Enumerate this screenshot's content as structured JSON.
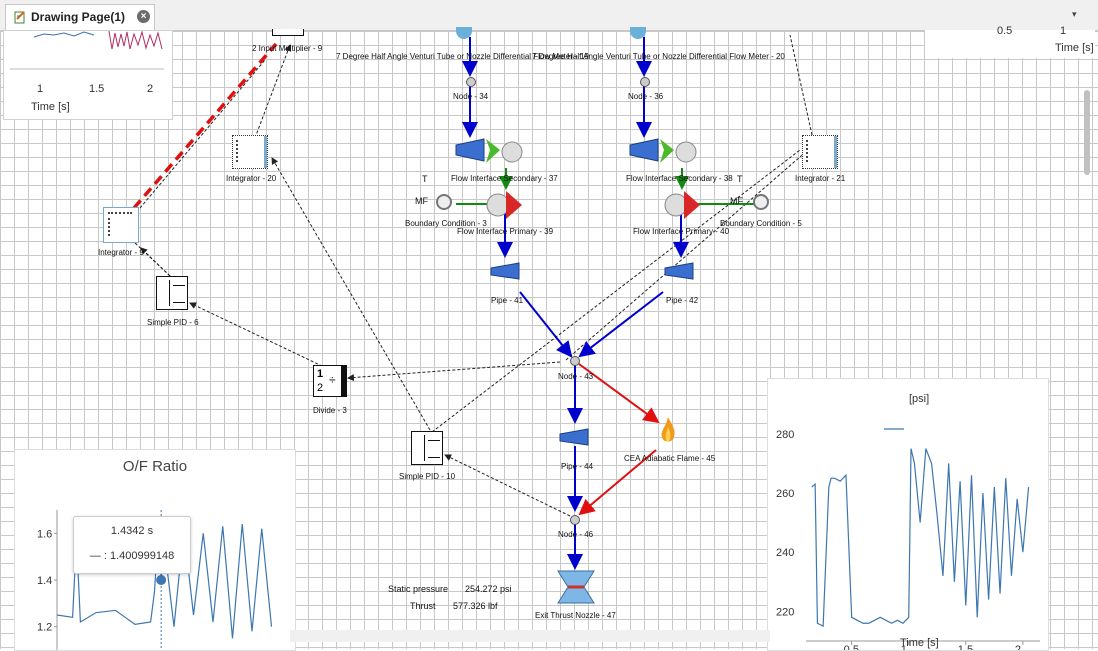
{
  "tab": {
    "title": "Drawing Page(1)",
    "close": "×"
  },
  "dropdown_icon": "▾",
  "components": {
    "multiplier": "2 Input Multiplier - 9",
    "venturi_left": "7 Degree Half Angle Venturi Tube or Nozzle Differential Flow Meter - 19",
    "venturi_right": "7 Degree Half Angle Venturi Tube or Nozzle Differential Flow Meter - 20",
    "node_left_top": "Node - 34",
    "node_right_top": "Node - 36",
    "integrator_20": "Integrator - 20",
    "integrator_21": "Integrator - 21",
    "integrator_9": "Integrator - 9",
    "flow_sec_left": "Flow Interface Secondary - 37",
    "flow_sec_right": "Flow Interface Secondary - 38",
    "t_left": "T",
    "mf_left": "MF",
    "t_right": "T",
    "mf_right": "MF",
    "boundary_3": "Boundary Condition - 3",
    "boundary_5": "Boundary Condition - 5",
    "flow_pri_left": "Flow Interface Primary - 39",
    "flow_pri_right": "Flow Interface Primary - 40",
    "pipe_41": "Pipe - 41",
    "pipe_42": "Pipe - 42",
    "pid_6": "Simple PID - 6",
    "node_43": "Node - 43",
    "divide_3": "Divide - 3",
    "divide_num": "1",
    "divide_den": "2",
    "divide_sym": "÷",
    "pipe_44": "Pipe - 44",
    "flame_45": "CEA Adiabatic Flame - 45",
    "pid_10": "Simple PID - 10",
    "node_46": "Node - 46",
    "nozzle_47": "Exit Thrust Nozzle - 47"
  },
  "readouts": {
    "static_pressure_label": "Static pressure",
    "static_pressure_value": "254.272 psi",
    "thrust_label": "Thrust",
    "thrust_value": "577.326 lbf"
  },
  "plot_topleft": {
    "ticks": [
      "1",
      "1.5",
      "2"
    ],
    "xlabel": "Time [s]"
  },
  "plot_topright": {
    "ticks": [
      "0.5",
      "1"
    ],
    "xlabel": "Time [s]"
  },
  "chart_data": [
    {
      "type": "line",
      "title": "O/F Ratio",
      "ylim": [
        1.1,
        1.7
      ],
      "yticks": [
        "1.6",
        "1.4",
        "1.2"
      ],
      "xlim": [
        0.9,
        2.1
      ],
      "tooltip": {
        "time": "1.4342 s",
        "value": "— : 1.400999148"
      },
      "series": [
        {
          "x": [
            0.9,
            0.98,
            1.0,
            1.02,
            1.1,
            1.2,
            1.3,
            1.38,
            1.4,
            1.42,
            1.434,
            1.45,
            1.5,
            1.55,
            1.6,
            1.65,
            1.7,
            1.75,
            1.8,
            1.85,
            1.9,
            1.95,
            2.0
          ],
          "y": [
            1.25,
            1.24,
            1.58,
            1.22,
            1.26,
            1.27,
            1.21,
            1.22,
            1.35,
            1.62,
            1.4,
            1.55,
            1.2,
            1.62,
            1.25,
            1.6,
            1.22,
            1.63,
            1.15,
            1.64,
            1.18,
            1.62,
            1.2
          ]
        }
      ]
    },
    {
      "type": "line",
      "title": "",
      "legend": "[psi]",
      "ylim": [
        210,
        285
      ],
      "yticks": [
        "280",
        "260",
        "240",
        "220"
      ],
      "xlim": [
        0.1,
        2.15
      ],
      "xticks": [
        "0.5",
        "1",
        "1.5",
        "2"
      ],
      "xlabel": "Time [s]",
      "series": [
        {
          "x": [
            0.15,
            0.18,
            0.2,
            0.25,
            0.3,
            0.32,
            0.35,
            0.4,
            0.45,
            0.5,
            0.55,
            0.6,
            0.65,
            0.7,
            0.75,
            0.8,
            0.85,
            0.9,
            0.95,
            1.0,
            1.02,
            1.05,
            1.1,
            1.15,
            1.2,
            1.25,
            1.3,
            1.35,
            1.4,
            1.45,
            1.5,
            1.55,
            1.6,
            1.65,
            1.7,
            1.75,
            1.8,
            1.85,
            1.9,
            1.95,
            2.0,
            2.05
          ],
          "y": [
            262,
            263,
            216,
            215,
            262,
            265,
            265,
            264,
            266,
            218,
            217,
            216,
            216,
            217,
            218,
            217,
            216,
            217,
            216,
            218,
            275,
            270,
            250,
            275,
            270,
            252,
            232,
            270,
            230,
            264,
            222,
            266,
            218,
            260,
            224,
            262,
            226,
            265,
            232,
            258,
            240,
            262
          ]
        }
      ]
    }
  ]
}
